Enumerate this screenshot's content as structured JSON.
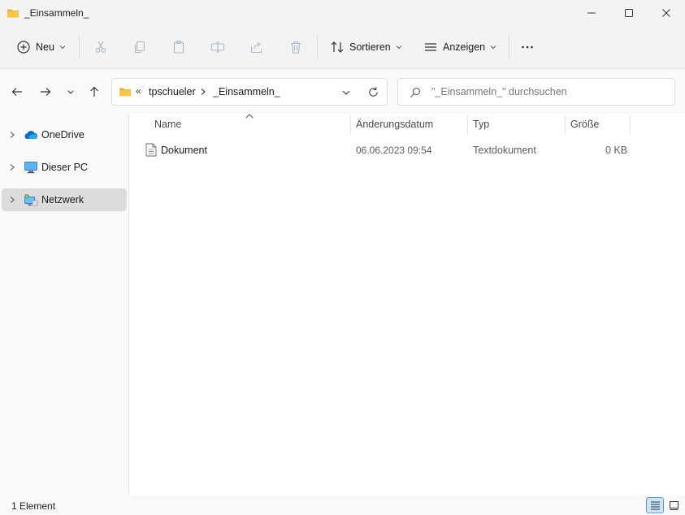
{
  "window": {
    "title": "_Einsammeln_"
  },
  "toolbar": {
    "new_label": "Neu",
    "sort_label": "Sortieren",
    "view_label": "Anzeigen",
    "more_label": "···"
  },
  "address": {
    "overflow": "«",
    "crumbs": [
      "tpschueler",
      "_Einsammeln_"
    ]
  },
  "search": {
    "placeholder": "\"_Einsammeln_\" durchsuchen"
  },
  "sidebar": {
    "items": [
      {
        "label": "OneDrive",
        "icon": "onedrive-cloud-icon"
      },
      {
        "label": "Dieser PC",
        "icon": "monitor-icon"
      },
      {
        "label": "Netzwerk",
        "icon": "network-icon",
        "selected": true
      }
    ]
  },
  "columns": {
    "name": "Name",
    "date": "Änderungsdatum",
    "type": "Typ",
    "size": "Größe"
  },
  "files": [
    {
      "name": "Dokument",
      "date": "06.06.2023 09:54",
      "type": "Textdokument",
      "size": "0 KB",
      "icon": "text-document-icon"
    }
  ],
  "status": {
    "count": "1 Element"
  },
  "colors": {
    "folder": "#f8c64a",
    "accent": "#0067c0",
    "selected": "#dcdcdc"
  }
}
